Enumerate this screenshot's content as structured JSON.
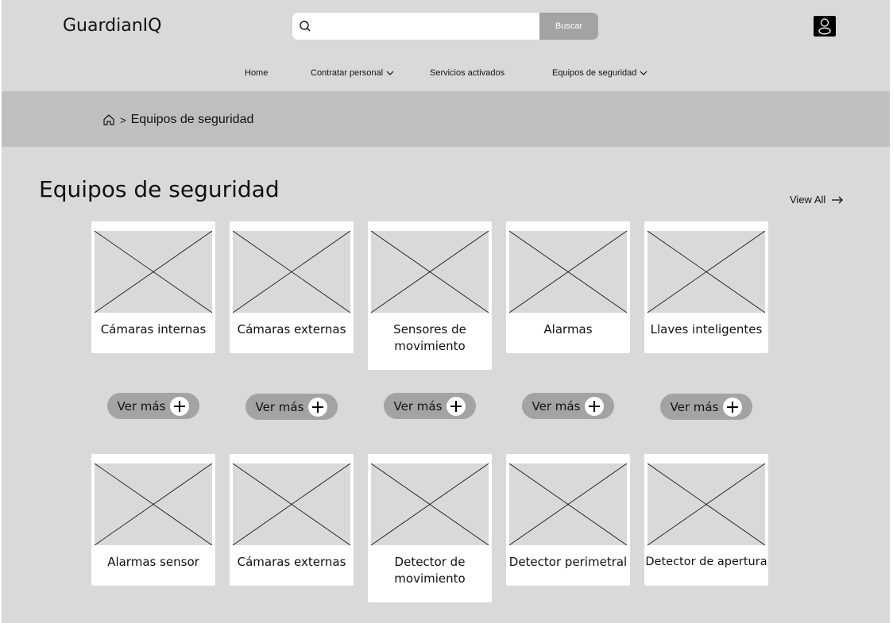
{
  "header": {
    "logo": "GuardianIQ",
    "search_placeholder": "",
    "search_button": "Buscar"
  },
  "nav": {
    "home": "Home",
    "hire": "Contratar personal",
    "services": "Servicios activados",
    "equipment": "Equipos de seguridad"
  },
  "breadcrumb": {
    "current": "Equipos de seguridad"
  },
  "section": {
    "title": "Equipos de seguridad",
    "view_all": "View All"
  },
  "row1": [
    {
      "label": "Cámaras internas",
      "button": "Ver más"
    },
    {
      "label": "Cámaras externas",
      "button": "Ver más"
    },
    {
      "label": "Sensores de movimiento",
      "button": "Ver más"
    },
    {
      "label": "Alarmas",
      "button": "Ver más"
    },
    {
      "label": "Llaves inteligentes",
      "button": "Ver más"
    }
  ],
  "row2": [
    {
      "label": "Alarmas sensor"
    },
    {
      "label": "Cámaras externas"
    },
    {
      "label": "Detector de movimiento"
    },
    {
      "label": "Detector perimetral"
    },
    {
      "label": "Detector de apertura"
    }
  ],
  "colors": {
    "background": "#d9d9d9",
    "breadcrumb_bar": "#c0bfbd",
    "button": "#a3a3a3",
    "card": "#ffffff"
  }
}
